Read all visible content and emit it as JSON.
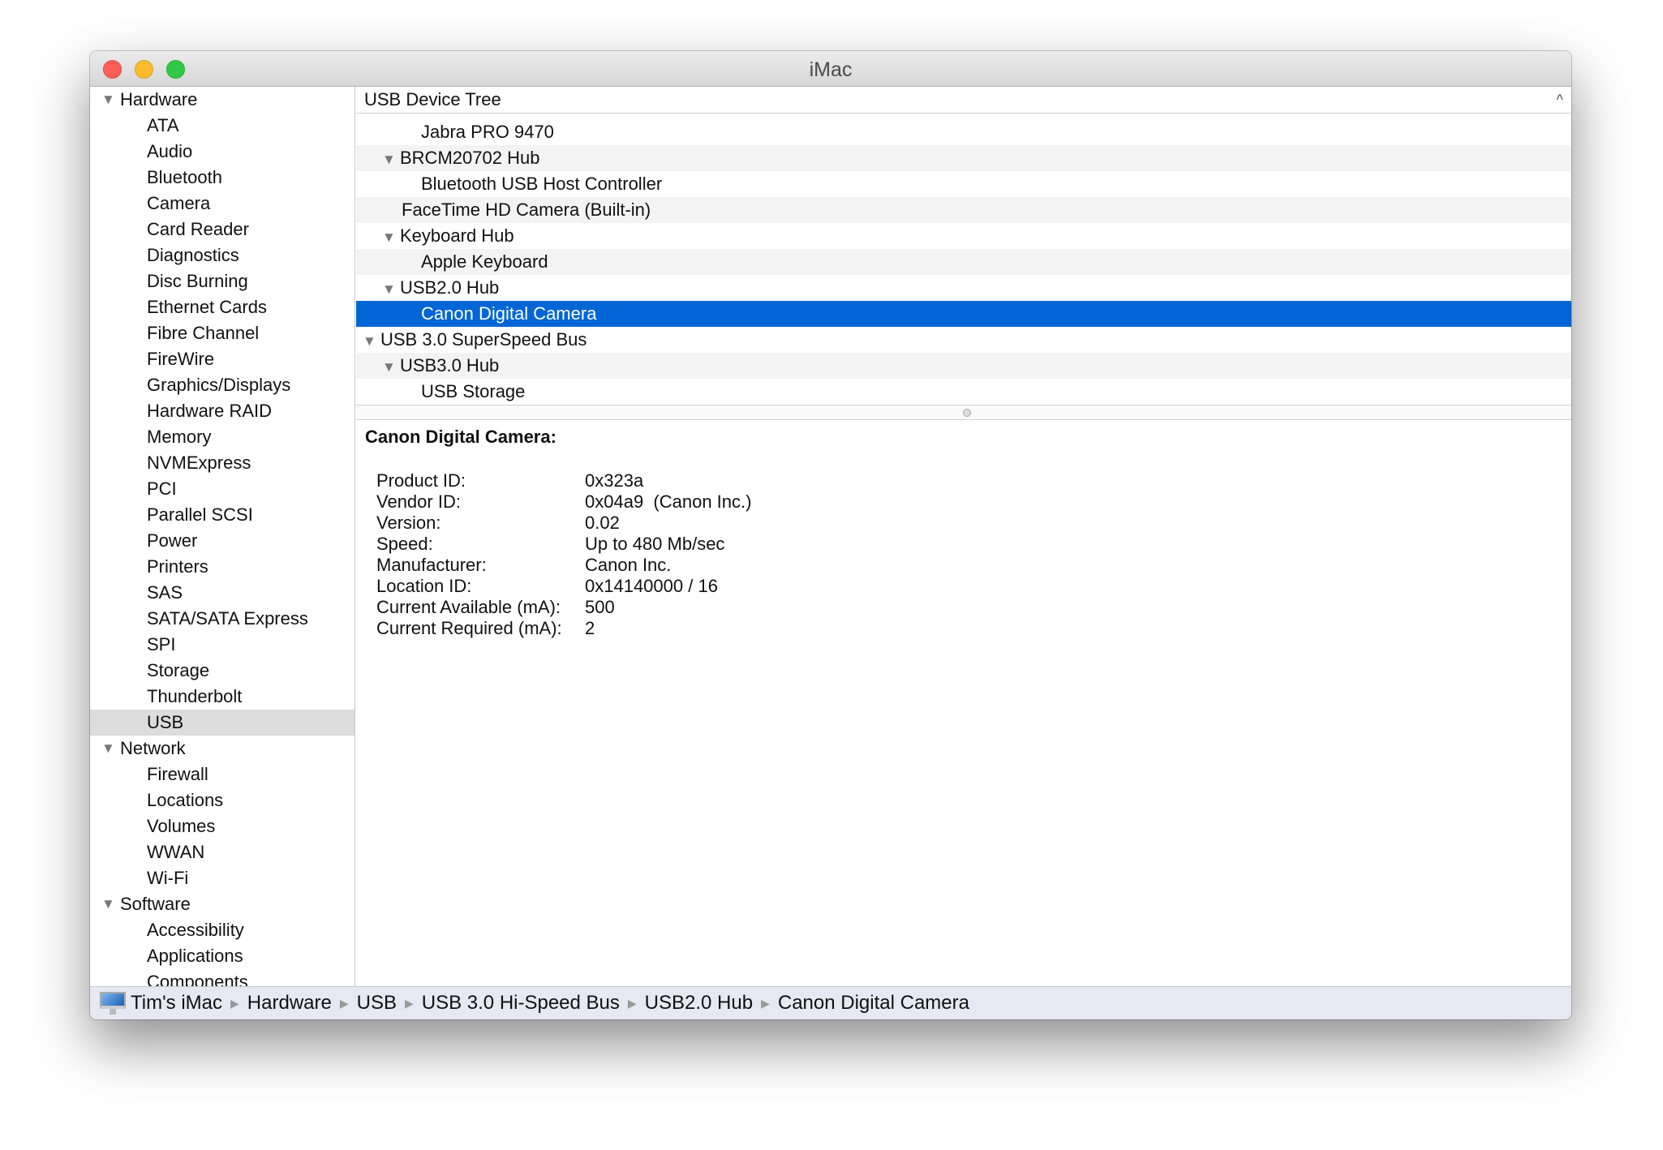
{
  "window": {
    "title": "iMac"
  },
  "sidebar": [
    {
      "type": "group",
      "label": "Hardware"
    },
    {
      "label": "ATA"
    },
    {
      "label": "Audio"
    },
    {
      "label": "Bluetooth"
    },
    {
      "label": "Camera"
    },
    {
      "label": "Card Reader"
    },
    {
      "label": "Diagnostics"
    },
    {
      "label": "Disc Burning"
    },
    {
      "label": "Ethernet Cards"
    },
    {
      "label": "Fibre Channel"
    },
    {
      "label": "FireWire"
    },
    {
      "label": "Graphics/Displays"
    },
    {
      "label": "Hardware RAID"
    },
    {
      "label": "Memory"
    },
    {
      "label": "NVMExpress"
    },
    {
      "label": "PCI"
    },
    {
      "label": "Parallel SCSI"
    },
    {
      "label": "Power"
    },
    {
      "label": "Printers"
    },
    {
      "label": "SAS"
    },
    {
      "label": "SATA/SATA Express"
    },
    {
      "label": "SPI"
    },
    {
      "label": "Storage"
    },
    {
      "label": "Thunderbolt"
    },
    {
      "label": "USB",
      "selected": true
    },
    {
      "type": "group",
      "label": "Network"
    },
    {
      "label": "Firewall"
    },
    {
      "label": "Locations"
    },
    {
      "label": "Volumes"
    },
    {
      "label": "WWAN"
    },
    {
      "label": "Wi-Fi"
    },
    {
      "type": "group",
      "label": "Software"
    },
    {
      "label": "Accessibility"
    },
    {
      "label": "Applications"
    },
    {
      "label": "Components"
    }
  ],
  "tree": {
    "header": "USB Device Tree",
    "rows": [
      {
        "label": "Jabra PRO 9470",
        "level": 2
      },
      {
        "label": "BRCM20702 Hub",
        "level": 1,
        "expanded": true
      },
      {
        "label": "Bluetooth USB Host Controller",
        "level": 2
      },
      {
        "label": "FaceTime HD Camera (Built-in)",
        "level": 1
      },
      {
        "label": "Keyboard Hub",
        "level": 1,
        "expanded": true
      },
      {
        "label": "Apple Keyboard",
        "level": 2
      },
      {
        "label": "USB2.0 Hub",
        "level": 1,
        "expanded": true
      },
      {
        "label": "Canon Digital Camera",
        "level": 2,
        "selected": true
      },
      {
        "label": "USB 3.0 SuperSpeed Bus",
        "level": 0,
        "expanded": true
      },
      {
        "label": "USB3.0 Hub",
        "level": 1,
        "expanded": true
      },
      {
        "label": "USB Storage",
        "level": 2
      }
    ]
  },
  "detail": {
    "title": "Canon Digital Camera:",
    "fields": [
      {
        "k": "Product ID:",
        "v": "0x323a"
      },
      {
        "k": "Vendor ID:",
        "v": "0x04a9  (Canon Inc.)"
      },
      {
        "k": "Version:",
        "v": "0.02"
      },
      {
        "k": "Speed:",
        "v": "Up to 480 Mb/sec"
      },
      {
        "k": "Manufacturer:",
        "v": "Canon Inc."
      },
      {
        "k": "Location ID:",
        "v": "0x14140000 / 16"
      },
      {
        "k": "Current Available (mA):",
        "v": "500"
      },
      {
        "k": "Current Required (mA):",
        "v": "2"
      }
    ]
  },
  "breadcrumb": [
    "Tim's iMac",
    "Hardware",
    "USB",
    "USB 3.0 Hi-Speed Bus",
    "USB2.0 Hub",
    "Canon Digital Camera"
  ]
}
